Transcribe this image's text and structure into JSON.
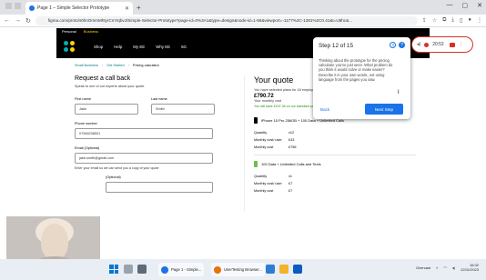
{
  "browser": {
    "tab_title": "Page 1 – Simple Selector Prototype",
    "url": "figma.com/proto/s0lmOmmMhtyrCmYqbvJ/Simple-Selector-Prototype?page-id=0%3A1&type=design&node-id=1-56&viewport=-1177%2C-1381%2C0.41&t=U8hc&..."
  },
  "site": {
    "top_links": [
      "Personal",
      "Business"
    ],
    "nav": [
      "Shop",
      "Help",
      "My EE",
      "Why EE",
      "5G"
    ],
    "login": "Login",
    "breadcrumb": [
      "Small Business",
      "Get Started",
      "Pricing calculator"
    ],
    "form": {
      "title": "Request a call back",
      "subtitle": "Speak to one of our experts about your quote.",
      "first_name_label": "First name",
      "first_name_value": "Jake",
      "last_name_label": "Last name",
      "last_name_value": "Smith",
      "phone_label": "Phone number",
      "phone_value": "07946238501",
      "email_label": "Email (Optional)",
      "email_value": "jake.smith@gmail.com",
      "email_help": "Enter your email so we can send you a copy of your quote",
      "partial_label": "(Optional)"
    },
    "quote": {
      "title": "Your quote",
      "selected": "You have selected plans for 18 employees",
      "price": "£790.72",
      "monthly": "Your monthly cost",
      "saving": "You will save £157.36 on our standard price",
      "plan1_title": "iPhone 15 Pro 256GB + 100 Data + Unlimited Calls",
      "plan1_rows": [
        {
          "k": "Quantity",
          "v": "x12"
        },
        {
          "k": "Monthly cost/ user",
          "v": "£43"
        },
        {
          "k": "Monthly cost",
          "v": "£756"
        }
      ],
      "plan2_title": "100 Data + Unlimited Calls and Texts",
      "plan2_rows": [
        {
          "k": "Quantity",
          "v": "x1"
        },
        {
          "k": "Monthly cost/ user",
          "v": "£7"
        },
        {
          "k": "Monthly cost",
          "v": "£7"
        }
      ]
    }
  },
  "guide": {
    "title": "Step 12 of 15",
    "body": "Thinking about the prototype for the pricing calculator you've just seen. What problem do you think it would solve or make easier? Describe it in your own words, not using language from the pages you saw.",
    "back": "Back",
    "next": "Next Step"
  },
  "recording": {
    "time": "20:52"
  },
  "taskbar": {
    "tasks": [
      "Page 1 - Simple...",
      "UserTesting Browser..."
    ],
    "weather": "Overcast",
    "time": "16:32",
    "date": "22/11/2023"
  }
}
